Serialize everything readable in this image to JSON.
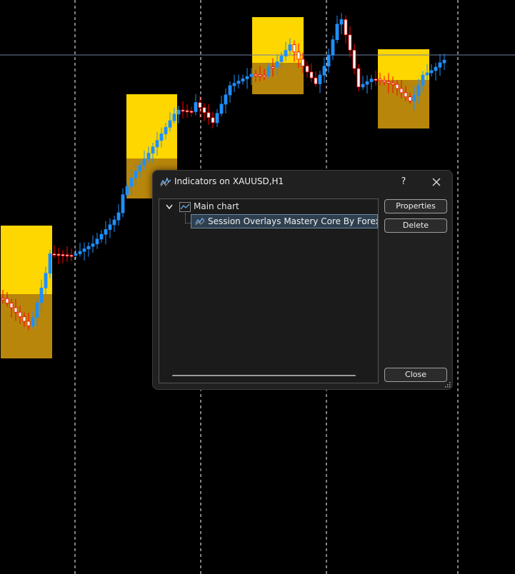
{
  "window": {
    "title": "Indicators on XAUUSD,H1",
    "help_label": "?",
    "close_icon": "close-icon"
  },
  "tree": {
    "root_label": "Main chart",
    "indicators": [
      {
        "label": "Session Overlays Mastery Core By Forex Noob Tutorial"
      }
    ]
  },
  "buttons": {
    "properties": "Properties",
    "delete": "Delete",
    "close": "Close"
  },
  "colors": {
    "background": "#000000",
    "bull_candle": "#1e90ff",
    "bear_candle": "#ffffff",
    "bear_outline": "#ff0000",
    "session_bright": "#ffd700",
    "session_dark": "#b8860b",
    "price_line": "#6b7fa8",
    "grid_line": "#ffffff",
    "selection_fill": "#2e3f4f",
    "selection_border": "#6f8aa3"
  }
}
